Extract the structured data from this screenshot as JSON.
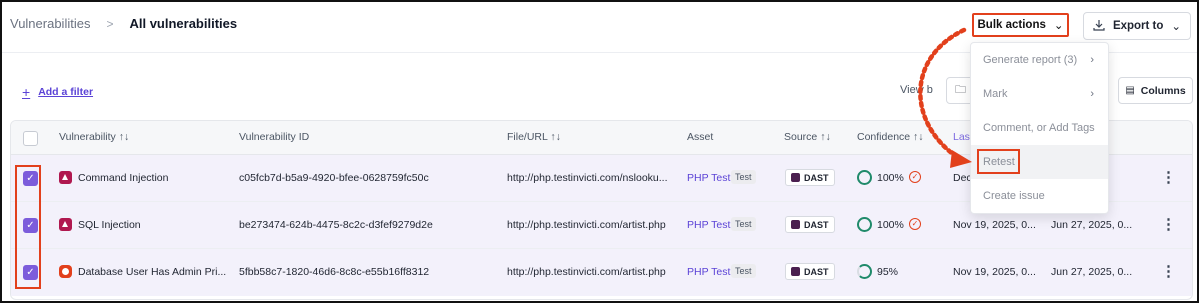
{
  "breadcrumb": {
    "root": "Vulnerabilities",
    "separator": ">",
    "current": "All vulnerabilities"
  },
  "toolbar": {
    "bulk_actions": "Bulk actions",
    "export_to": "Export to",
    "add_filter": "Add a filter",
    "view_by": "View b",
    "columns": "Columns"
  },
  "menu": {
    "items": [
      {
        "label": "Generate report (3)",
        "has_submenu": true
      },
      {
        "label": "Mark",
        "has_submenu": true
      },
      {
        "label": "Comment, or Add Tags",
        "has_submenu": false
      },
      {
        "label": "Retest",
        "has_submenu": false
      },
      {
        "label": "Create issue",
        "has_submenu": false
      }
    ]
  },
  "table": {
    "headers": {
      "vulnerability": "Vulnerability",
      "vulnerability_id": "Vulnerability ID",
      "file_url": "File/URL",
      "asset": "Asset",
      "source": "Source",
      "confidence": "Confidence",
      "last": "Last"
    },
    "sort_glyph": "↑↓",
    "rows": [
      {
        "name": "Command Injection",
        "id": "c05fcb7d-b5a9-4920-bfee-0628759fc50c",
        "url": "http://php.testinvicti.com/nslooku...",
        "asset": "PHP Test",
        "tag": "Test",
        "source": "DAST",
        "confidence": "100%",
        "verified": true,
        "last_seen": "Dec",
        "first_seen": "",
        "selected": true
      },
      {
        "name": "SQL Injection",
        "id": "be273474-624b-4475-8c2c-d3fef9279d2e",
        "url": "http://php.testinvicti.com/artist.php",
        "asset": "PHP Test",
        "tag": "Test",
        "source": "DAST",
        "confidence": "100%",
        "verified": true,
        "last_seen": "Nov 19, 2025, 0...",
        "first_seen": "Jun 27, 2025, 0...",
        "selected": true
      },
      {
        "name": "Database User Has Admin Pri...",
        "id": "5fbb58c7-1820-46d6-8c8c-e55b16ff8312",
        "url": "http://php.testinvicti.com/artist.php",
        "asset": "PHP Test",
        "tag": "Test",
        "source": "DAST",
        "confidence": "95%",
        "verified": false,
        "last_seen": "Nov 19, 2025, 0...",
        "first_seen": "Jun 27, 2025, 0...",
        "selected": true
      }
    ]
  },
  "icons": {
    "kebab": "⋮",
    "check": "✓",
    "chevron": "⌄",
    "download": "download-icon",
    "plus": "+"
  },
  "colors": {
    "accent": "#5b43d6",
    "highlight": "#e2401c",
    "checkbox": "#7c5cdb",
    "confidence": "#1f8a6a"
  }
}
